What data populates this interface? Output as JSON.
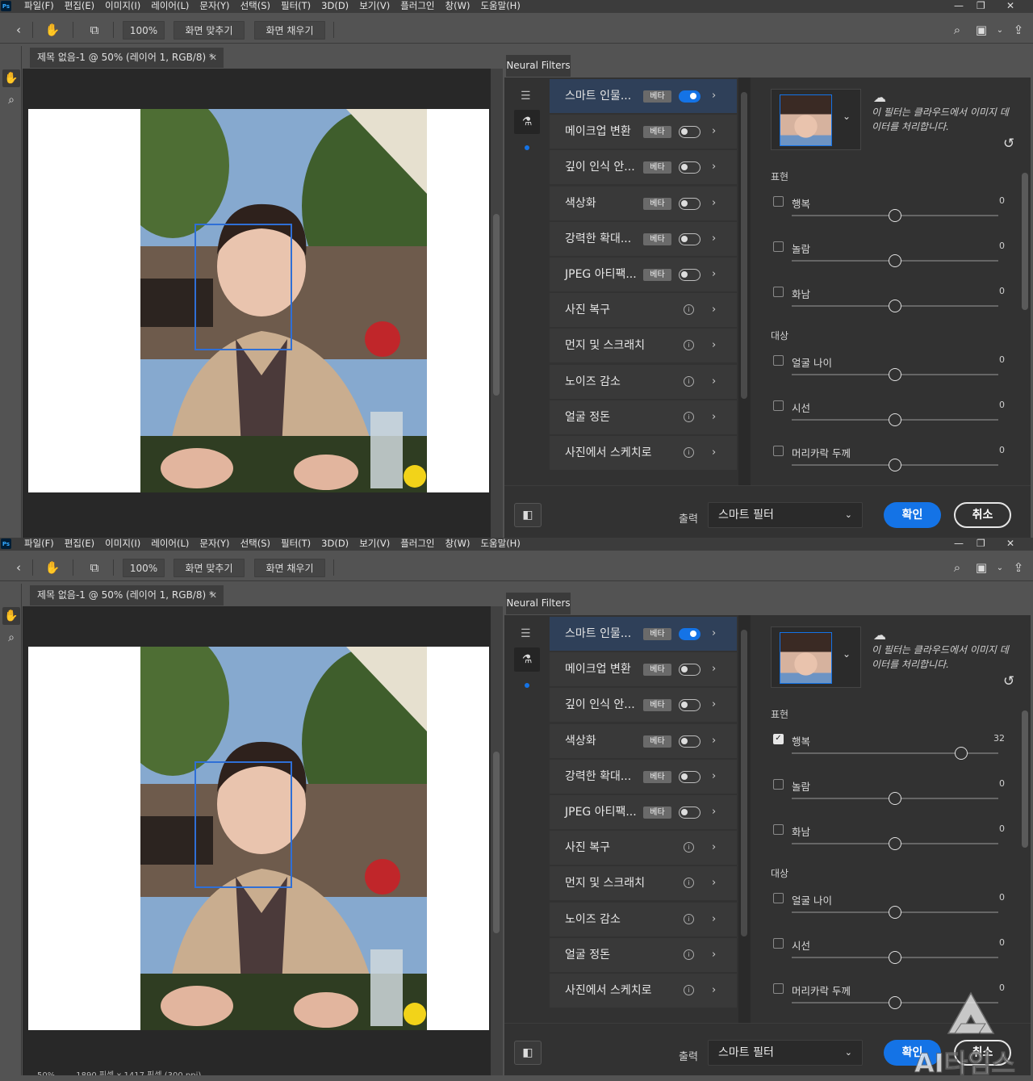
{
  "menubar": {
    "logo": "Ps",
    "items": [
      "파일(F)",
      "편집(E)",
      "이미지(I)",
      "레이어(L)",
      "문자(Y)",
      "선택(S)",
      "필터(T)",
      "3D(D)",
      "보기(V)",
      "플러그인",
      "창(W)",
      "도움말(H)"
    ]
  },
  "options": {
    "zoom": "100%",
    "fit_screen": "화면 맞추기",
    "fill_screen": "화면 채우기"
  },
  "document": {
    "tab_title": "제목 없음-1 @ 50% (레이어 1, RGB/8) *"
  },
  "neural_filters": {
    "tab_label": "Neural Filters",
    "beta_label": "베타",
    "filters": [
      {
        "name": "스마트 인물...",
        "beta": true
      },
      {
        "name": "메이크업 변환",
        "beta": true
      },
      {
        "name": "깊이 인식 안...",
        "beta": true
      },
      {
        "name": "색상화",
        "beta": true
      },
      {
        "name": "강력한 확대...",
        "beta": true
      },
      {
        "name": "JPEG 아티팩...",
        "beta": true
      },
      {
        "name": "사진 복구",
        "beta": false
      },
      {
        "name": "먼지 및 스크래치",
        "beta": false
      },
      {
        "name": "노이즈 감소",
        "beta": false
      },
      {
        "name": "얼굴 정돈",
        "beta": false
      },
      {
        "name": "사진에서 스케치로",
        "beta": false
      }
    ],
    "cloud_note": "이 필터는 클라우드에서 이미지 데이터를 처리합니다.",
    "sections": {
      "expression": "표현",
      "target": "대상"
    },
    "output_label": "출력",
    "output_value": "스마트 필터",
    "ok_label": "확인",
    "cancel_label": "취소"
  },
  "states": [
    {
      "smart_portrait_on": true,
      "params": {
        "expression": [
          {
            "label": "행복",
            "value": 0,
            "checked": false
          },
          {
            "label": "놀람",
            "value": 0,
            "checked": false
          },
          {
            "label": "화남",
            "value": 0,
            "checked": false
          }
        ],
        "target": [
          {
            "label": "얼굴 나이",
            "value": 0,
            "checked": false
          },
          {
            "label": "시선",
            "value": 0,
            "checked": false
          },
          {
            "label": "머리카락 두께",
            "value": 0,
            "checked": false
          }
        ]
      }
    },
    {
      "smart_portrait_on": true,
      "params": {
        "expression": [
          {
            "label": "행복",
            "value": 32,
            "checked": true
          },
          {
            "label": "놀람",
            "value": 0,
            "checked": false
          },
          {
            "label": "화남",
            "value": 0,
            "checked": false
          }
        ],
        "target": [
          {
            "label": "얼굴 나이",
            "value": 0,
            "checked": false
          },
          {
            "label": "시선",
            "value": 0,
            "checked": false
          },
          {
            "label": "머리카락 두께",
            "value": 0,
            "checked": false
          }
        ]
      }
    }
  ],
  "statusbar": {
    "zoom": "50%",
    "doc_size": "1890 픽셀 x 1417 픽셀 (300 ppi)"
  },
  "watermark": {
    "text": "AI타임스"
  }
}
